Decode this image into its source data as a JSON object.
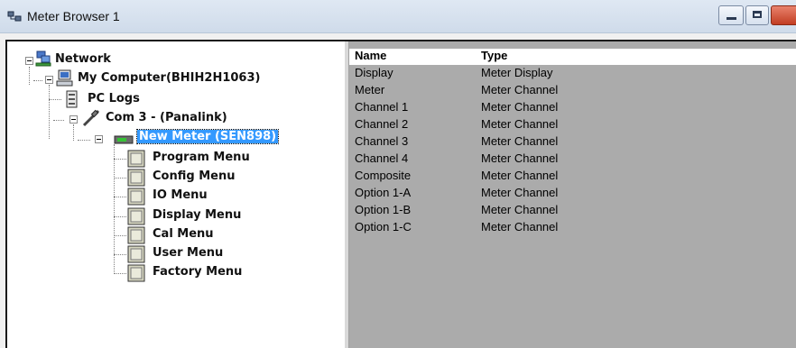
{
  "window": {
    "title": "Meter Browser 1"
  },
  "tree": {
    "nodes": [
      {
        "label": "Network",
        "icon": "network-icon"
      },
      {
        "label": "My Computer(BHIH2H1063)",
        "icon": "computer-icon"
      },
      {
        "label": "PC Logs",
        "icon": "logs-icon"
      },
      {
        "label": "Com 3 -  (Panalink)",
        "icon": "serial-port-icon"
      },
      {
        "label": "New Meter (SEN898)",
        "icon": "meter-icon",
        "selected": true
      },
      {
        "label": "Program Menu",
        "icon": "menu-panel-icon"
      },
      {
        "label": "Config Menu",
        "icon": "menu-panel-icon"
      },
      {
        "label": "IO Menu",
        "icon": "menu-panel-icon"
      },
      {
        "label": "Display Menu",
        "icon": "menu-panel-icon"
      },
      {
        "label": "Cal Menu",
        "icon": "menu-panel-icon"
      },
      {
        "label": "User Menu",
        "icon": "menu-panel-icon"
      },
      {
        "label": "Factory Menu",
        "icon": "menu-panel-icon"
      }
    ]
  },
  "list": {
    "columns": {
      "name": "Name",
      "type": "Type"
    },
    "rows": [
      {
        "name": "Display",
        "type": "Meter Display"
      },
      {
        "name": "Meter",
        "type": "Meter Channel"
      },
      {
        "name": "Channel 1",
        "type": "Meter Channel"
      },
      {
        "name": "Channel 2",
        "type": "Meter Channel"
      },
      {
        "name": "Channel 3",
        "type": "Meter Channel"
      },
      {
        "name": "Channel 4",
        "type": "Meter Channel"
      },
      {
        "name": "Composite",
        "type": "Meter Channel"
      },
      {
        "name": "Option 1-A",
        "type": "Meter Channel"
      },
      {
        "name": "Option 1-B",
        "type": "Meter Channel"
      },
      {
        "name": "Option 1-C",
        "type": "Meter Channel"
      }
    ]
  },
  "colors": {
    "selection": "#3399ff",
    "list_background": "#ababab"
  }
}
